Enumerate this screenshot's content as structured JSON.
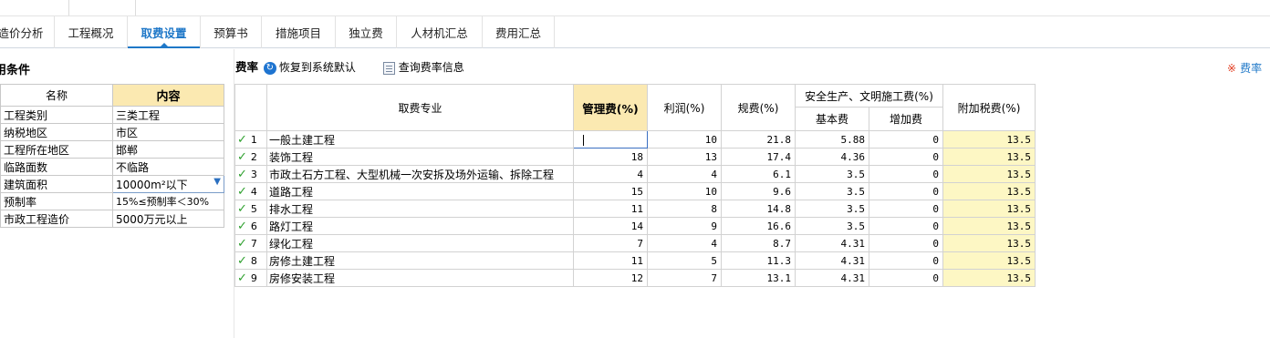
{
  "tabs": [
    {
      "label": "造价分析",
      "active": false
    },
    {
      "label": "工程概况",
      "active": false
    },
    {
      "label": "取费设置",
      "active": true
    },
    {
      "label": "预算书",
      "active": false
    },
    {
      "label": "措施项目",
      "active": false
    },
    {
      "label": "独立费",
      "active": false
    },
    {
      "label": "人材机汇总",
      "active": false
    },
    {
      "label": "费用汇总",
      "active": false
    }
  ],
  "left_panel": {
    "title": "用条件",
    "headers": {
      "name": "名称",
      "content": "内容"
    },
    "rows": [
      {
        "name": "工程类别",
        "value": "三类工程"
      },
      {
        "name": "纳税地区",
        "value": "市区"
      },
      {
        "name": "工程所在地区",
        "value": "邯郸"
      },
      {
        "name": "临路面数",
        "value": "不临路"
      },
      {
        "name": "建筑面积",
        "value": "10000m²以下"
      },
      {
        "name": "预制率",
        "value": "15%≤预制率＜30%"
      },
      {
        "name": "市政工程造价",
        "value": "5000万元以上"
      }
    ]
  },
  "toolbar": {
    "label": "费率",
    "reset_label": "恢复到系统默认",
    "query_label": "查询费率信息",
    "right_link": "费率"
  },
  "rate_table": {
    "headers": {
      "specialty": "取费专业",
      "management": "管理费(%)",
      "profit": "利润(%)",
      "regulation": "规费(%)",
      "safety_group": "安全生产、文明施工费(%)",
      "basic": "基本费",
      "additional": "增加费",
      "surtax": "附加税费(%)"
    },
    "rows": [
      {
        "no": "1",
        "name": "一般土建工程",
        "management": "",
        "profit": "10",
        "regulation": "21.8",
        "basic": "5.88",
        "additional": "0",
        "surtax": "13.5"
      },
      {
        "no": "2",
        "name": "装饰工程",
        "management": "18",
        "profit": "13",
        "regulation": "17.4",
        "basic": "4.36",
        "additional": "0",
        "surtax": "13.5"
      },
      {
        "no": "3",
        "name": "市政土石方工程、大型机械一次安拆及场外运输、拆除工程",
        "management": "4",
        "profit": "4",
        "regulation": "6.1",
        "basic": "3.5",
        "additional": "0",
        "surtax": "13.5"
      },
      {
        "no": "4",
        "name": "道路工程",
        "management": "15",
        "profit": "10",
        "regulation": "9.6",
        "basic": "3.5",
        "additional": "0",
        "surtax": "13.5"
      },
      {
        "no": "5",
        "name": "排水工程",
        "management": "11",
        "profit": "8",
        "regulation": "14.8",
        "basic": "3.5",
        "additional": "0",
        "surtax": "13.5"
      },
      {
        "no": "6",
        "name": "路灯工程",
        "management": "14",
        "profit": "9",
        "regulation": "16.6",
        "basic": "3.5",
        "additional": "0",
        "surtax": "13.5"
      },
      {
        "no": "7",
        "name": "绿化工程",
        "management": "7",
        "profit": "4",
        "regulation": "8.7",
        "basic": "4.31",
        "additional": "0",
        "surtax": "13.5"
      },
      {
        "no": "8",
        "name": "房修土建工程",
        "management": "11",
        "profit": "5",
        "regulation": "11.3",
        "basic": "4.31",
        "additional": "0",
        "surtax": "13.5"
      },
      {
        "no": "9",
        "name": "房修安装工程",
        "management": "12",
        "profit": "7",
        "regulation": "13.1",
        "basic": "4.31",
        "additional": "0",
        "surtax": "13.5"
      }
    ]
  },
  "colors": {
    "accent": "#1f78c8",
    "header_highlight": "#fbe9b1",
    "cell_highlight": "#fdf7c4",
    "check": "#2ea02e"
  }
}
